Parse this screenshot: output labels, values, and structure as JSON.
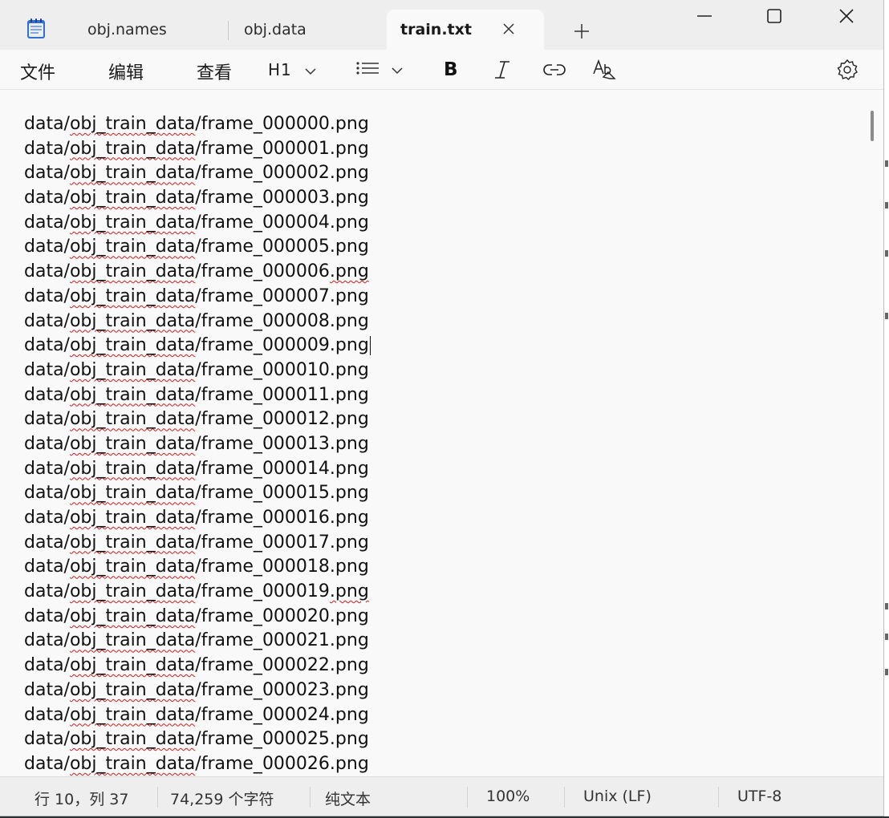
{
  "tabs": [
    {
      "label": "obj.names",
      "active": false
    },
    {
      "label": "obj.data",
      "active": false
    },
    {
      "label": "train.txt",
      "active": true
    }
  ],
  "menu": {
    "file": "文件",
    "edit": "编辑",
    "view": "查看"
  },
  "toolbar": {
    "heading": "H1",
    "bold": "B"
  },
  "editor": {
    "prefix": "data/",
    "folder": "obj_train_data",
    "file_prefix": "/frame_",
    "extension": ".png",
    "lines": [
      "000000",
      "000001",
      "000002",
      "000003",
      "000004",
      "000005",
      "000006",
      "000007",
      "000008",
      "000009",
      "000010",
      "000011",
      "000012",
      "000013",
      "000014",
      "000015",
      "000016",
      "000017",
      "000018",
      "000019",
      "000020",
      "000021",
      "000022",
      "000023",
      "000024",
      "000025",
      "000026"
    ],
    "caret_line": 10
  },
  "status": {
    "position": "行 10，列 37",
    "characters": "74,259 个字符",
    "format": "纯文本",
    "zoom": "100%",
    "line_ending": "Unix (LF)",
    "encoding": "UTF-8"
  },
  "colors": {
    "accent": "#1e4fc4",
    "squiggle": "#d21c1c",
    "background": "#f9f9f9"
  }
}
